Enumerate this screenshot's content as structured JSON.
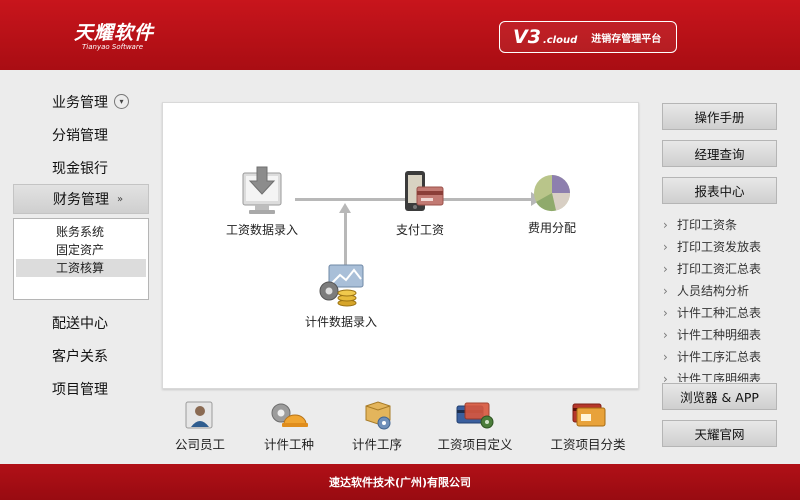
{
  "header": {
    "logo_cn": "天耀软件",
    "logo_en": "Tianyao Software",
    "version": "V3",
    "version_suffix": ".cloud",
    "version_sub": "进销存管理平台"
  },
  "nav": {
    "items": [
      {
        "label": "业务管理"
      },
      {
        "label": "分销管理"
      },
      {
        "label": "现金银行"
      },
      {
        "label": "财务管理"
      },
      {
        "label": "配送中心"
      },
      {
        "label": "客户关系"
      },
      {
        "label": "项目管理"
      }
    ],
    "sub_items": [
      {
        "label": "账务系统"
      },
      {
        "label": "固定资产"
      },
      {
        "label": "工资核算"
      }
    ]
  },
  "flow": {
    "nodes": [
      {
        "label": "工资数据录入",
        "icon": "computer-down-icon"
      },
      {
        "label": "支付工资",
        "icon": "payment-card-icon"
      },
      {
        "label": "费用分配",
        "icon": "pie-chart-icon"
      },
      {
        "label": "计件数据录入",
        "icon": "gear-coins-icon"
      }
    ]
  },
  "bottom": {
    "items": [
      {
        "label": "公司员工",
        "icon": "employee-icon"
      },
      {
        "label": "计件工种",
        "icon": "worker-helmet-icon"
      },
      {
        "label": "计件工序",
        "icon": "process-box-icon"
      },
      {
        "label": "工资项目定义",
        "icon": "cards-gear-icon"
      },
      {
        "label": "工资项目分类",
        "icon": "card-folder-icon"
      }
    ]
  },
  "right": {
    "buttons": {
      "manual": "操作手册",
      "manager_query": "经理查询",
      "report_center": "报表中心",
      "browser_app": "浏览器 & APP",
      "official_site": "天耀官网"
    },
    "reports": [
      "打印工资条",
      "打印工资发放表",
      "打印工资汇总表",
      "人员结构分析",
      "计件工种汇总表",
      "计件工种明细表",
      "计件工序汇总表",
      "计件工序明细表"
    ]
  },
  "footer": {
    "text": "速达软件技术(广州)有限公司"
  }
}
